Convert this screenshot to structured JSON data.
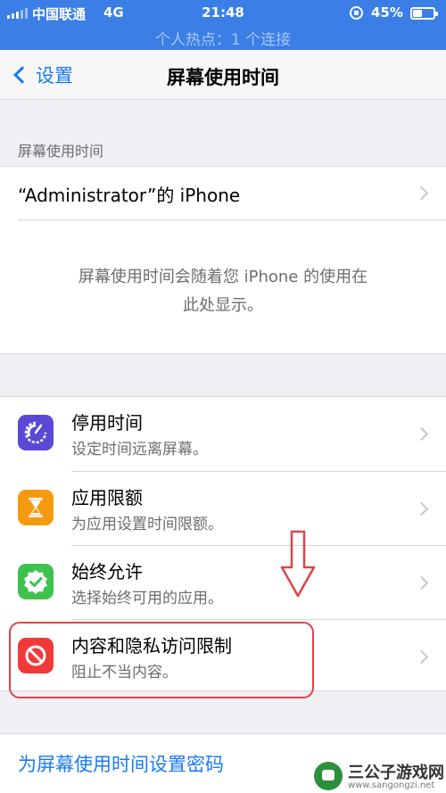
{
  "status_bar": {
    "carrier": "中国联通",
    "network": "4G",
    "time": "21:48",
    "battery_percent": "45%",
    "battery_level": 0.45,
    "hotspot": "个人热点：1 个连接"
  },
  "nav": {
    "back_label": "设置",
    "title": "屏幕使用时间"
  },
  "section_header": "屏幕使用时间",
  "device": {
    "name": "“Administrator”的 iPhone"
  },
  "summary": {
    "line1": "屏幕使用时间会随着您 iPhone 的使用在",
    "line2": "此处显示。"
  },
  "items": [
    {
      "title": "停用时间",
      "subtitle": "设定时间远离屏幕。",
      "icon": "downtime-icon",
      "color": "#5a49d6"
    },
    {
      "title": "应用限额",
      "subtitle": "为应用设置时间限额。",
      "icon": "hourglass-icon",
      "color": "#f59a0e"
    },
    {
      "title": "始终允许",
      "subtitle": "选择始终可用的应用。",
      "icon": "checkmark-badge-icon",
      "color": "#3ec24f"
    },
    {
      "title": "内容和隐私访问限制",
      "subtitle": "阻止不当内容。",
      "icon": "no-entry-icon",
      "color": "#f03a3a"
    }
  ],
  "passcode_link": "为屏幕使用时间设置密码",
  "watermark": {
    "title": "三公子游戏网",
    "url": "www.sangongzi.net"
  },
  "colors": {
    "status_bar_bg": "#3a7ee6",
    "tint": "#1a7af5",
    "annotation": "#e0434b"
  }
}
